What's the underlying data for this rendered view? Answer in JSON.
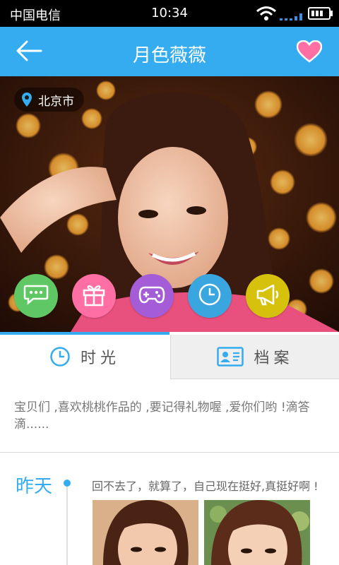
{
  "status_bar": {
    "carrier": "中国电信",
    "time": "10:34"
  },
  "header": {
    "title": "月色薇薇",
    "back_icon": "arrow-left-icon",
    "favorite_icon": "heart-icon",
    "background": "#35acf0",
    "favorite_color": "#ff6fa3"
  },
  "hero": {
    "location": "北京市"
  },
  "actions": [
    {
      "name": "chat",
      "icon": "chat-bubble-icon",
      "color": "#5fc864"
    },
    {
      "name": "gift",
      "icon": "gift-icon",
      "color": "#ff6fa3"
    },
    {
      "name": "game",
      "icon": "gamepad-icon",
      "color": "#a45dd6"
    },
    {
      "name": "time",
      "icon": "clock-icon",
      "color": "#3aa6e0"
    },
    {
      "name": "broadcast",
      "icon": "megaphone-icon",
      "color": "#d6c20d"
    }
  ],
  "tabs": [
    {
      "label": "时光",
      "icon": "clock-icon",
      "active": true
    },
    {
      "label": "档案",
      "icon": "profile-card-icon",
      "active": false
    }
  ],
  "intro": "宝贝们 ,喜欢桃桃作品的 ,要记得礼物喔 ,爱你们哟 !滴答滴......",
  "timeline": {
    "day_label": "昨天",
    "post_text": "回不去了，就算了，自己现在挺好,真挺好啊 !"
  }
}
